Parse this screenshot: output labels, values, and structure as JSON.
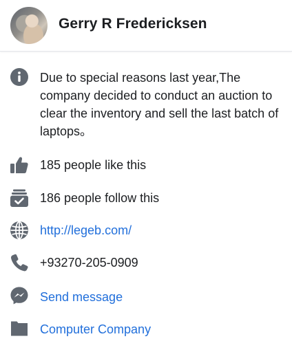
{
  "page": {
    "name": "Gerry R Fredericksen",
    "about": "Due to special reasons last year,The company decided to conduct an auction to clear the inventory and sell the last batch of laptops。",
    "likes": "185 people like this",
    "follows": "186 people follow this",
    "website": "http://legeb.com/",
    "phone": "+93270-205-0909",
    "message": "Send message",
    "category": "Computer Company"
  },
  "colors": {
    "icon": "#606770",
    "link": "#216fdb",
    "text": "#1c1e21"
  },
  "icons": [
    "info-icon",
    "thumbs-up-icon",
    "follow-check-icon",
    "globe-icon",
    "phone-icon",
    "messenger-icon",
    "category-icon"
  ]
}
